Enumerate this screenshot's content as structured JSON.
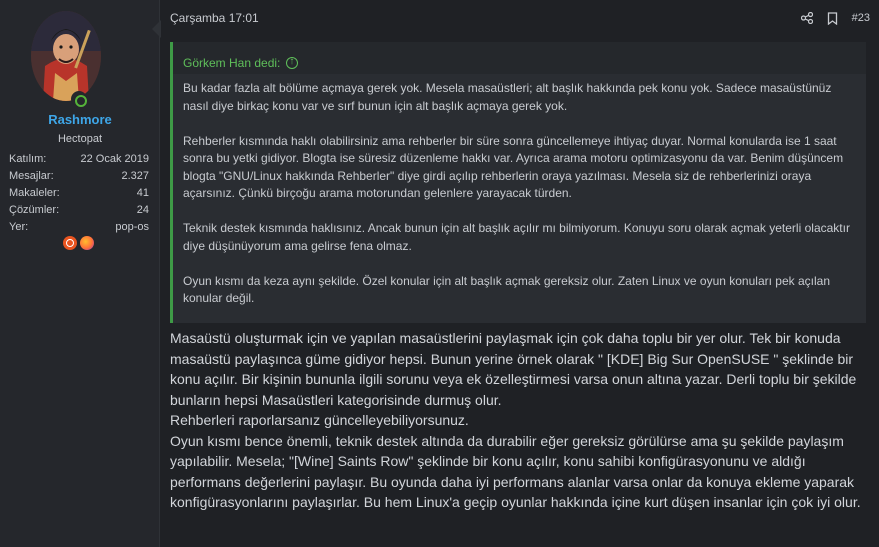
{
  "user": {
    "name": "Rashmore",
    "title": "Hectopat",
    "stats": [
      {
        "label": "Katılım:",
        "value": "22 Ocak 2019"
      },
      {
        "label": "Mesajlar:",
        "value": "2.327"
      },
      {
        "label": "Makaleler:",
        "value": "41"
      },
      {
        "label": "Çözümler:",
        "value": "24"
      },
      {
        "label": "Yer:",
        "value": "pop-os"
      }
    ],
    "os_icons": [
      "ubuntu-icon",
      "firefox-icon"
    ]
  },
  "post": {
    "date": "Çarşamba 17:01",
    "number": "#23",
    "quote": {
      "author": "Görkem Han dedi:",
      "paragraphs": [
        "Bu kadar fazla alt bölüme açmaya gerek yok. Mesela masaüstleri; alt başlık hakkında pek konu yok. Sadece masaüstünüz nasıl diye birkaç konu var ve sırf bunun için alt başlık açmaya gerek yok.",
        "Rehberler kısmında haklı olabilirsiniz ama rehberler bir süre sonra güncellemeye ihtiyaç duyar. Normal konularda ise 1 saat sonra bu yetki gidiyor. Blogta ise süresiz düzenleme hakkı var. Ayrıca arama motoru optimizasyonu da var. Benim düşüncem blogta \"GNU/Linux hakkında Rehberler\" diye girdi açılıp rehberlerin oraya yazılması. Mesela siz de rehberlerinizi oraya açarsınız. Çünkü birçoğu arama motorundan gelenlere yarayacak türden.",
        "Teknik destek kısmında haklısınız. Ancak bunun için alt başlık açılır mı bilmiyorum. Konuyu soru olarak açmak yeterli olacaktır diye düşünüyorum ama gelirse fena olmaz.",
        "Oyun kısmı da keza aynı şekilde. Özel konular için alt başlık açmak gereksiz olur. Zaten Linux ve oyun konuları pek açılan konular değil."
      ]
    },
    "body": [
      "Masaüstü oluşturmak için ve yapılan masaüstlerini paylaşmak için çok daha toplu bir yer olur. Tek bir konuda masaüstü paylaşınca güme gidiyor hepsi. Bunun yerine örnek olarak \" [KDE] Big Sur OpenSUSE \" şeklinde bir konu açılır. Bir kişinin bununla ilgili sorunu veya ek özelleştirmesi varsa onun altına yazar. Derli toplu bir şekilde bunların hepsi Masaüstleri kategorisinde durmuş olur.",
      "Rehberleri raporlarsanız güncelleyebiliyorsunuz.",
      "Oyun kısmı bence önemli, teknik destek altında da durabilir eğer gereksiz görülürse ama şu şekilde paylaşım yapılabilir. Mesela; \"[Wine] Saints Row\" şeklinde bir konu açılır, konu sahibi konfigürasyonunu ve aldığı performans değerlerini paylaşır. Bu oyunda daha iyi performans alanlar varsa onlar da konuya ekleme yaparak konfigürasyonlarını paylaşırlar. Bu hem Linux'a geçip oyunlar hakkında içine kurt düşen insanlar için çok iyi olur."
    ]
  }
}
